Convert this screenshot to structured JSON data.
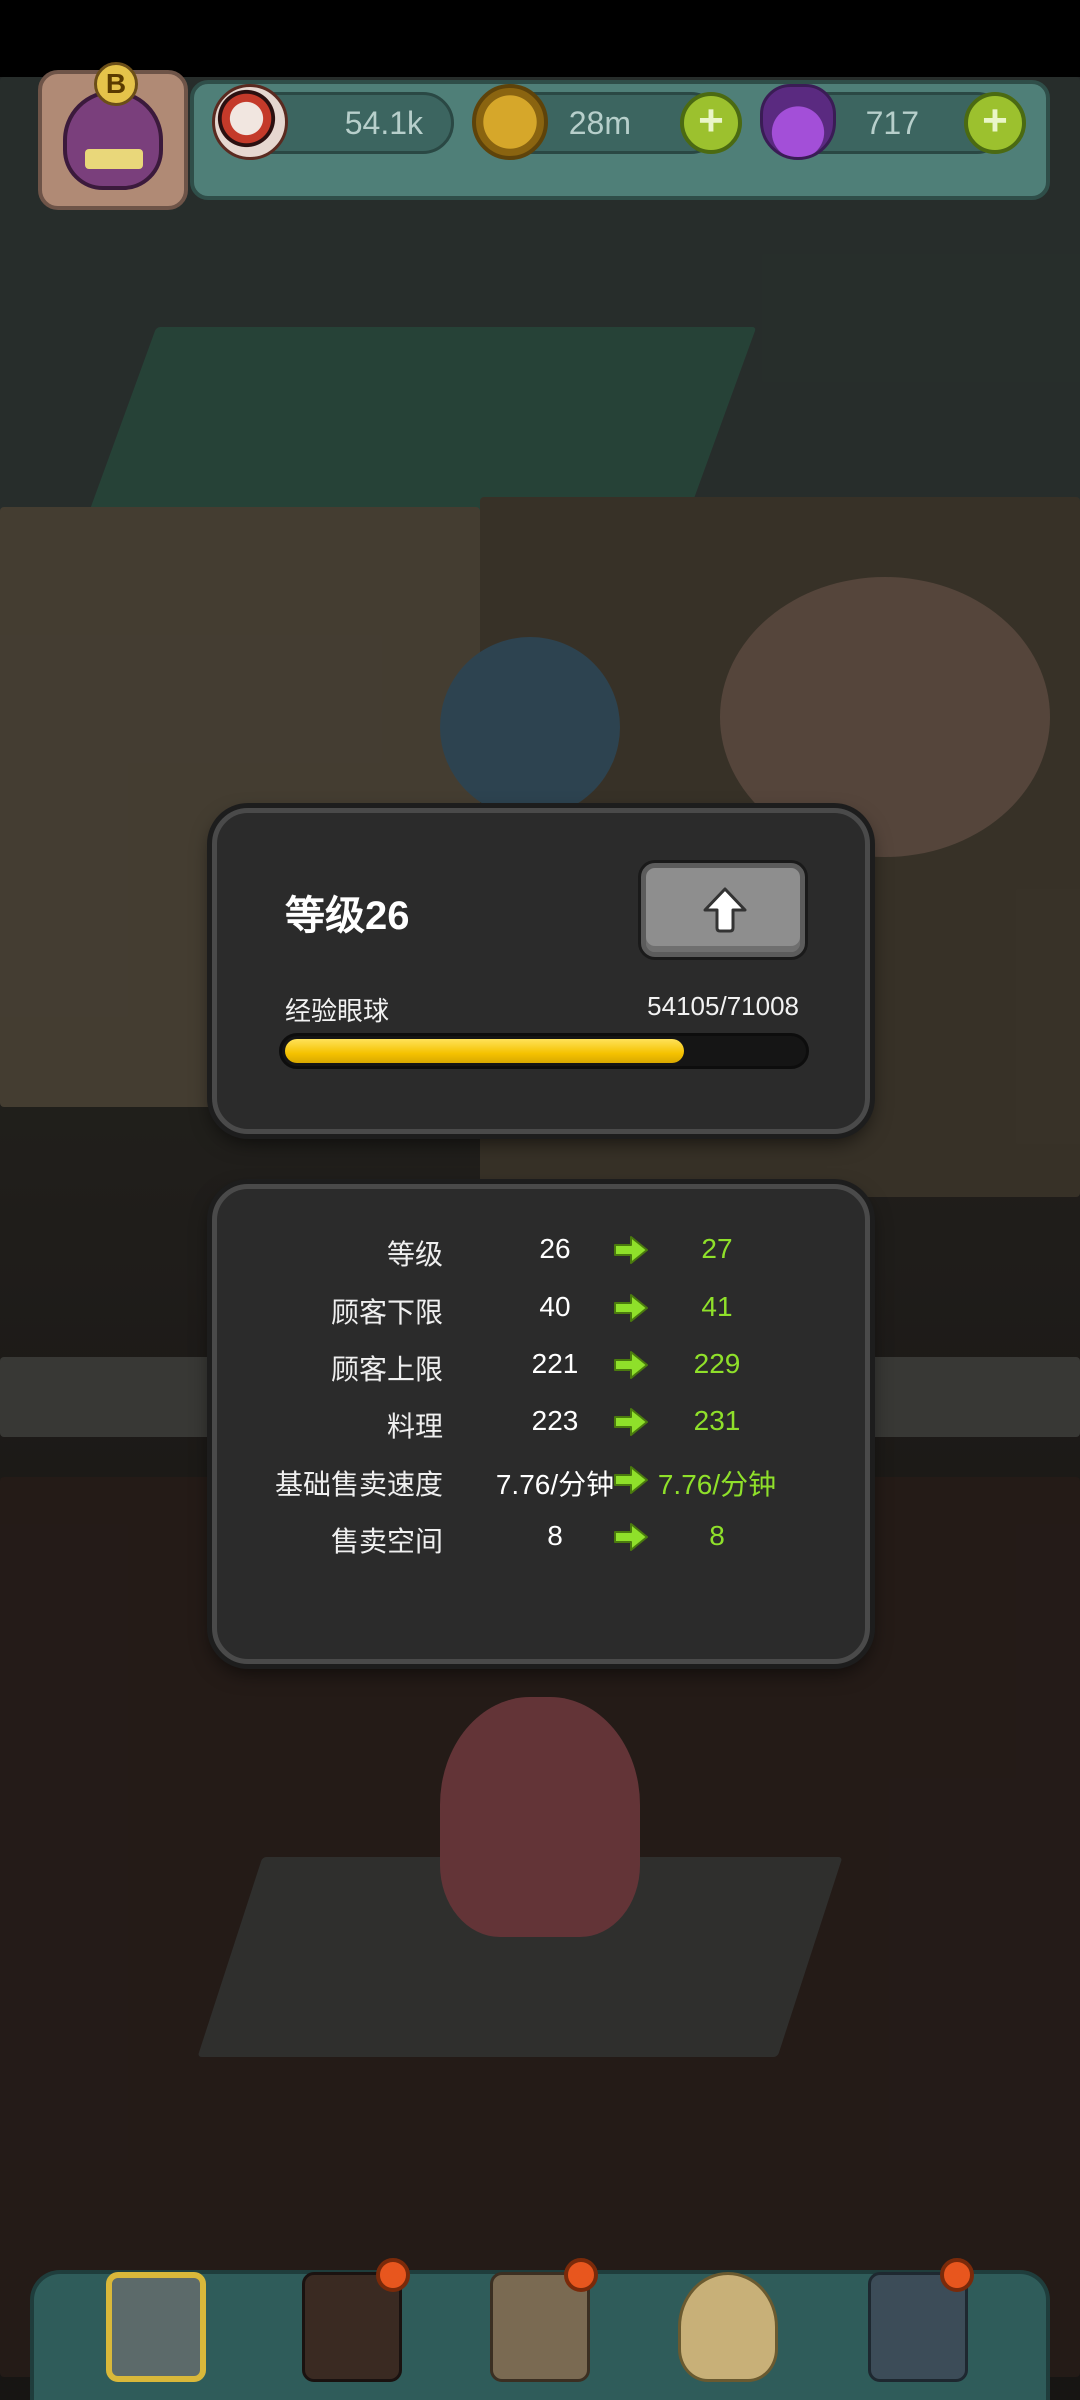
{
  "hud": {
    "avatar_badge": "B",
    "eyeballs": "54.1k",
    "coins": "28m",
    "potions": "717",
    "add_symbol": "+"
  },
  "level_panel": {
    "title": "等级26",
    "exp_label": "经验眼球",
    "exp_value": "54105/71008",
    "exp_current": 54105,
    "exp_max": 71008
  },
  "stats": [
    {
      "name": "等级",
      "current": "26",
      "next": "27"
    },
    {
      "name": "顾客下限",
      "current": "40",
      "next": "41"
    },
    {
      "name": "顾客上限",
      "current": "221",
      "next": "229"
    },
    {
      "name": "料理",
      "current": "223",
      "next": "231"
    },
    {
      "name": "基础售卖速度",
      "current": "7.76/分钟",
      "next": "7.76/分钟"
    },
    {
      "name": "售卖空间",
      "current": "8",
      "next": "8"
    }
  ],
  "colors": {
    "panel_bg": "#2b2b2b",
    "bar_fill": "#f5c200",
    "next_value": "#8fe02a",
    "hud_bg": "#4f7f78"
  },
  "icons": {
    "eyeball": "eyeball-icon",
    "coin": "coin-icon",
    "potion": "potion-icon",
    "upgrade": "arrow-up-icon",
    "stat_arrow": "arrow-right-icon"
  }
}
